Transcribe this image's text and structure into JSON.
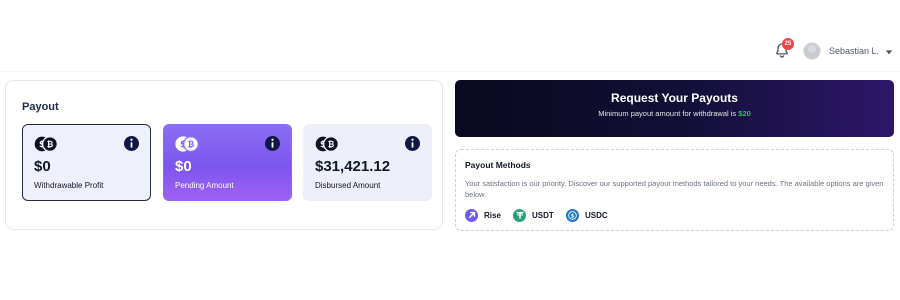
{
  "header": {
    "notification_count": "25",
    "user_name": "Sebastian L."
  },
  "payout": {
    "title": "Payout",
    "cards": [
      {
        "amount": "$0",
        "label": "Withdrawable Profit"
      },
      {
        "amount": "$0",
        "label": "Pending Amount"
      },
      {
        "amount": "$31,421.12",
        "label": "Disbursed Amount"
      }
    ]
  },
  "request": {
    "title": "Request Your Payouts",
    "subtitle_prefix": "Minimum payout amount for withdrawal is",
    "min_amount": "$20"
  },
  "methods": {
    "title": "Payout Methods",
    "description": "Your satisfaction is our priority. Discover our supported payout methods tailored to your needs. The available options are given below.",
    "items": [
      {
        "label": "Rise",
        "icon": "rise-icon",
        "color": "#6b5cf6"
      },
      {
        "label": "USDT",
        "icon": "usdt-icon",
        "color": "#26a17b"
      },
      {
        "label": "USDC",
        "icon": "usdc-icon",
        "color": "#2775ca"
      }
    ]
  },
  "colors": {
    "accent_purple": "#7c56f0",
    "dark_navy": "#110f35",
    "success_green": "#22c55e",
    "badge_red": "#ef4444"
  }
}
